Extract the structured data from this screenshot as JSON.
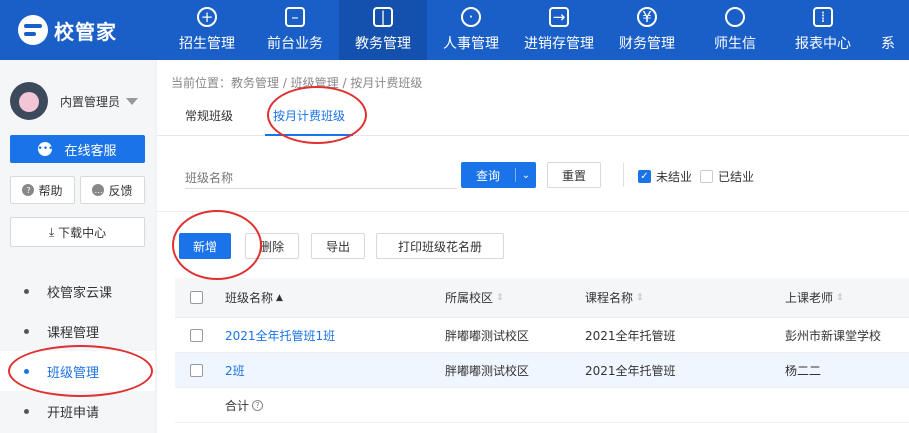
{
  "app": {
    "logo_text": "校管家"
  },
  "nav": {
    "items": [
      {
        "label": "招生管理",
        "icon": "user-plus-icon",
        "glyph": "+"
      },
      {
        "label": "前台业务",
        "icon": "monitor-icon",
        "glyph": "▭"
      },
      {
        "label": "教务管理",
        "icon": "book-icon",
        "glyph": "▯"
      },
      {
        "label": "人事管理",
        "icon": "person-icon",
        "glyph": "◯"
      },
      {
        "label": "进销存管理",
        "icon": "inventory-icon",
        "glyph": "➜"
      },
      {
        "label": "财务管理",
        "icon": "yen-shield-icon",
        "glyph": "¥"
      },
      {
        "label": "师生信",
        "icon": "chat-bubble-icon",
        "glyph": "◌"
      },
      {
        "label": "报表中心",
        "icon": "chart-icon",
        "glyph": "▥"
      },
      {
        "label": "系",
        "icon": "settings-icon",
        "glyph": ""
      }
    ],
    "active_index": 2
  },
  "sidebar": {
    "user_name": "内置管理员",
    "service_label": "在线客服",
    "help_label": "帮助",
    "feedback_label": "反馈",
    "download_label": "下载中心",
    "menu": [
      {
        "label": "校管家云课"
      },
      {
        "label": "课程管理"
      },
      {
        "label": "班级管理"
      },
      {
        "label": "开班申请"
      }
    ],
    "active_menu_index": 2
  },
  "main": {
    "breadcrumb": "当前位置：教务管理 / 班级管理 / 按月计费班级",
    "tabs": [
      {
        "label": "常规班级"
      },
      {
        "label": "按月计费班级"
      }
    ],
    "active_tab_index": 1,
    "filter": {
      "placeholder": "班级名称",
      "query_label": "查询",
      "reset_label": "重置",
      "chk_unfinished": "未结业",
      "chk_unfinished_checked": true,
      "chk_finished": "已结业",
      "chk_finished_checked": false
    },
    "actions": {
      "add": "新增",
      "delete": "删除",
      "export": "导出",
      "print": "打印班级花名册"
    },
    "table": {
      "columns": [
        "班级名称",
        "所属校区",
        "课程名称",
        "上课老师"
      ],
      "rows": [
        {
          "class_name": "2021全年托管班1班",
          "campus": "胖嘟嘟测试校区",
          "course": "2021全年托管班",
          "teacher": "彭州市新课堂学校"
        },
        {
          "class_name": "2班",
          "campus": "胖嘟嘟测试校区",
          "course": "2021全年托管班",
          "teacher": "杨二二"
        }
      ],
      "total_label": "合计"
    }
  },
  "colors": {
    "nav_bg": "#1a5fc7",
    "accent": "#1a73e8",
    "annotation": "#e03030"
  }
}
